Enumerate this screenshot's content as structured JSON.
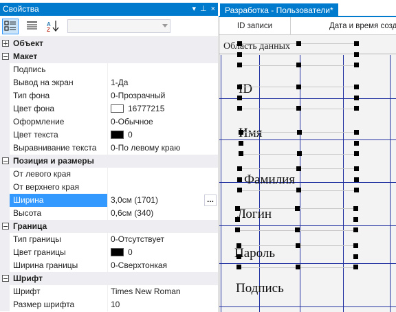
{
  "properties_panel": {
    "title": "Свойства",
    "title_icons": [
      "pin-icon",
      "close-icon"
    ],
    "pin_glyph": "⊥",
    "close_glyph": "×",
    "toolbar": {
      "buttons": [
        "categorized-view-icon",
        "alphabetical-list-icon",
        "sort-az-icon"
      ],
      "sort_glyph": "A↓",
      "object_selector_value": ""
    },
    "rows": [
      {
        "type": "category",
        "expanded": false,
        "label": "Объект"
      },
      {
        "type": "category",
        "expanded": true,
        "label": "Макет"
      },
      {
        "type": "prop",
        "name": "Подпись",
        "value": ""
      },
      {
        "type": "prop",
        "name": "Вывод на экран",
        "value": "1-Да"
      },
      {
        "type": "prop",
        "name": "Тип фона",
        "value": "0-Прозрачный"
      },
      {
        "type": "prop",
        "name": "Цвет фона",
        "value": "16777215",
        "swatch": "#ffffff"
      },
      {
        "type": "prop",
        "name": "Оформление",
        "value": "0-Обычное"
      },
      {
        "type": "prop",
        "name": "Цвет текста",
        "value": "0",
        "swatch": "#000000"
      },
      {
        "type": "prop",
        "name": "Выравнивание текста",
        "value": "0-По левому краю"
      },
      {
        "type": "category",
        "expanded": true,
        "label": "Позиция и размеры"
      },
      {
        "type": "prop",
        "name": "От левого края",
        "value": ""
      },
      {
        "type": "prop",
        "name": "От верхнего края",
        "value": ""
      },
      {
        "type": "prop",
        "name": "Ширина",
        "value": "3,0см (1701)",
        "selected": true,
        "button": "..."
      },
      {
        "type": "prop",
        "name": "Высота",
        "value": "0,6см (340)"
      },
      {
        "type": "category",
        "expanded": true,
        "label": "Граница"
      },
      {
        "type": "prop",
        "name": "Тип границы",
        "value": "0-Отсутствует"
      },
      {
        "type": "prop",
        "name": "Цвет границы",
        "value": "0",
        "swatch": "#000000"
      },
      {
        "type": "prop",
        "name": "Ширина границы",
        "value": "0-Сверхтонкая"
      },
      {
        "type": "category",
        "expanded": true,
        "label": "Шрифт"
      },
      {
        "type": "prop",
        "name": "Шрифт",
        "value": "Times New Roman"
      },
      {
        "type": "prop",
        "name": "Размер шрифта",
        "value": "10"
      }
    ]
  },
  "designer": {
    "tab_title": "Разработка - Пользователи*",
    "columns": [
      "ID записи",
      "Дата и время созд"
    ],
    "section_label": "Область данных",
    "fields": [
      "ID",
      "Имя",
      "Фамилия",
      "Логин",
      "Пароль",
      "Подпись"
    ],
    "grid_line_color": "#1f2fa0"
  },
  "colors": {
    "accent": "#007acc",
    "selection": "#3399ff",
    "category_bg": "#eeeef2",
    "canvas_bg": "#f3f3f3"
  }
}
